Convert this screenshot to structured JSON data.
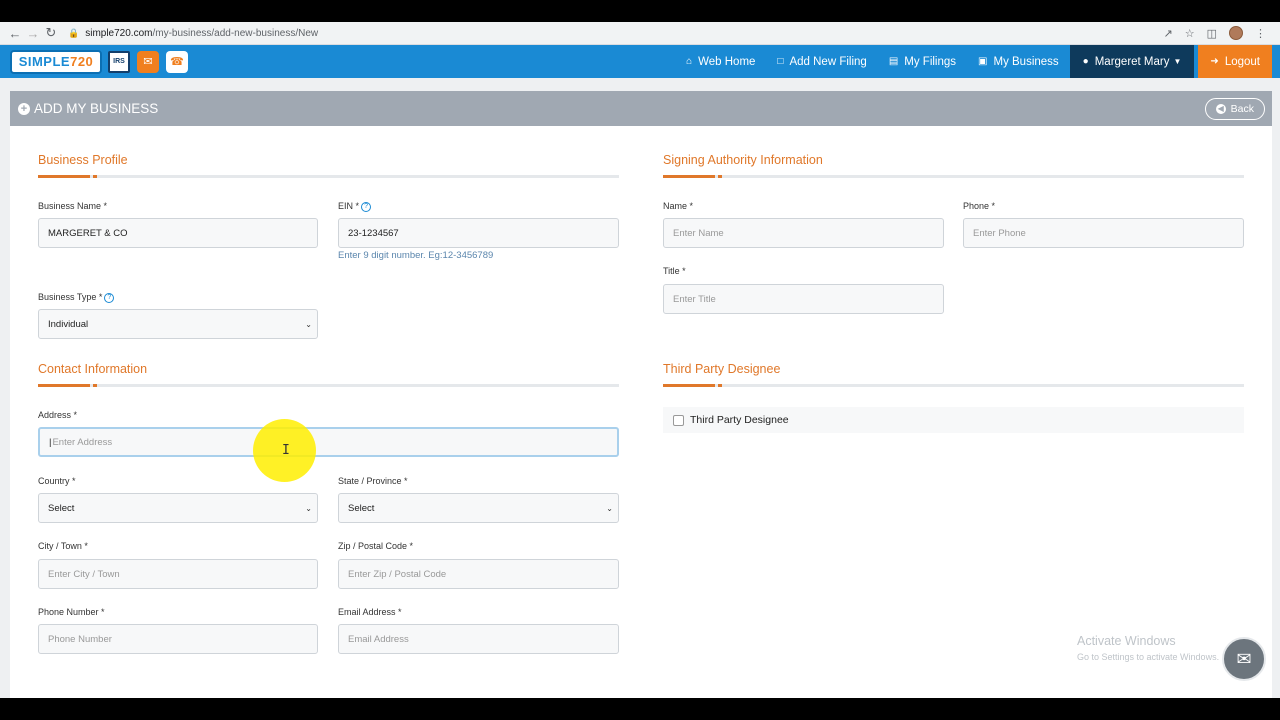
{
  "browser": {
    "url_host": "simple720.com",
    "url_path": "/my-business/add-new-business/New"
  },
  "app": {
    "logo_text": "SIMPLE",
    "logo_num": "720",
    "irs_badge": "IRS",
    "nav": [
      {
        "label": "Web Home",
        "icon": "home-icon"
      },
      {
        "label": "Add New Filing",
        "icon": "file-icon"
      },
      {
        "label": "My Filings",
        "icon": "list-icon"
      },
      {
        "label": "My Business",
        "icon": "briefcase-icon"
      }
    ],
    "user_name": "Margeret Mary",
    "logout_label": "Logout"
  },
  "page": {
    "title": "ADD MY BUSINESS",
    "back_label": "Back"
  },
  "business_profile": {
    "title": "Business Profile",
    "business_name_label": "Business Name *",
    "business_name_value": "MARGERET & CO",
    "ein_label": "EIN *",
    "ein_value": "23-1234567",
    "ein_hint": "Enter 9 digit number. Eg:12-3456789",
    "business_type_label": "Business Type *",
    "business_type_value": "Individual"
  },
  "signing_authority": {
    "title": "Signing Authority Information",
    "name_label": "Name *",
    "name_placeholder": "Enter Name",
    "phone_label": "Phone *",
    "phone_placeholder": "Enter Phone",
    "title_label": "Title *",
    "title_placeholder": "Enter Title"
  },
  "contact": {
    "title": "Contact Information",
    "address_label": "Address *",
    "address_placeholder": "Enter Address",
    "country_label": "Country *",
    "country_value": "Select",
    "state_label": "State / Province *",
    "state_value": "Select",
    "city_label": "City / Town *",
    "city_placeholder": "Enter City / Town",
    "zip_label": "Zip / Postal Code *",
    "zip_placeholder": "Enter Zip / Postal Code",
    "phone_label": "Phone Number *",
    "phone_placeholder": "Phone Number",
    "email_label": "Email Address *",
    "email_placeholder": "Email Address"
  },
  "third_party": {
    "title": "Third Party Designee",
    "checkbox_label": "Third Party Designee"
  },
  "watermark": {
    "line1": "Activate Windows",
    "line2": "Go to Settings to activate Windows."
  }
}
